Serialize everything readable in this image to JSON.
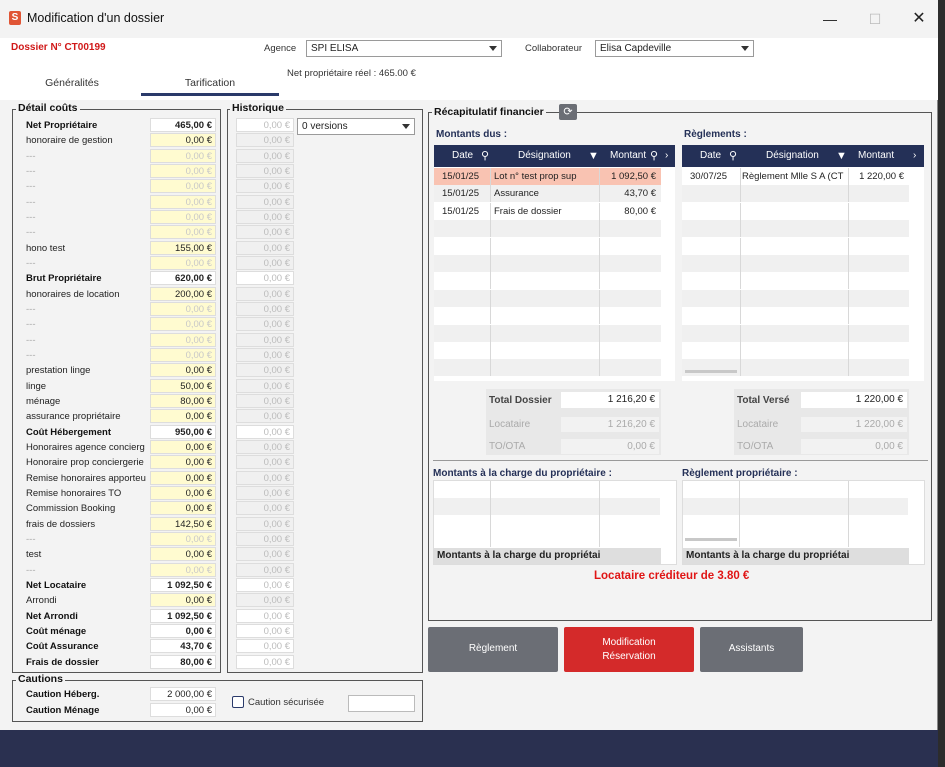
{
  "window": {
    "title": "Modification d'un dossier"
  },
  "header": {
    "dossier_label": "Dossier N° CT00199",
    "agence_label": "Agence",
    "agence_value": "SPI ELISA",
    "collaborateur_label": "Collaborateur",
    "collaborateur_value": "Elisa Capdeville",
    "net_proprietaire": "Net propriétaire réel : 465.00 €"
  },
  "tabs": [
    {
      "label": "Généralités"
    },
    {
      "label": "Tarification"
    }
  ],
  "detail": {
    "title": "Détail coûts",
    "rows": [
      {
        "label": "Net Propriétaire",
        "value": "465,00 €",
        "style": "bold-white"
      },
      {
        "label": "honoraire de gestion",
        "value": "0,00 €",
        "style": "yellow"
      },
      {
        "label": "---",
        "value": "0,00 €",
        "style": "dim"
      },
      {
        "label": "---",
        "value": "0,00 €",
        "style": "dim"
      },
      {
        "label": "---",
        "value": "0,00 €",
        "style": "dim"
      },
      {
        "label": "---",
        "value": "0,00 €",
        "style": "dim"
      },
      {
        "label": "---",
        "value": "0,00 €",
        "style": "dim"
      },
      {
        "label": "---",
        "value": "0,00 €",
        "style": "dim"
      },
      {
        "label": "hono test",
        "value": "155,00 €",
        "style": "yellow"
      },
      {
        "label": "---",
        "value": "0,00 €",
        "style": "dim"
      },
      {
        "label": "Brut Propriétaire",
        "value": "620,00 €",
        "style": "bold-white"
      },
      {
        "label": "honoraires  de location",
        "value": "200,00 €",
        "style": "yellow"
      },
      {
        "label": "---",
        "value": "0,00 €",
        "style": "dim"
      },
      {
        "label": "---",
        "value": "0,00 €",
        "style": "dim"
      },
      {
        "label": "---",
        "value": "0,00 €",
        "style": "dim"
      },
      {
        "label": "---",
        "value": "0,00 €",
        "style": "dim"
      },
      {
        "label": "prestation linge",
        "value": "0,00 €",
        "style": "yellow"
      },
      {
        "label": "linge",
        "value": "50,00 €",
        "style": "yellow"
      },
      {
        "label": "ménage",
        "value": "80,00 €",
        "style": "yellow"
      },
      {
        "label": "assurance propriétaire",
        "value": "0,00 €",
        "style": "yellow"
      },
      {
        "label": "Coût Hébergement",
        "value": "950,00 €",
        "style": "bold-white"
      },
      {
        "label": "Honoraires agence concierg",
        "value": "0,00 €",
        "style": "yellow"
      },
      {
        "label": "Honoraire prop conciergerie",
        "value": "0,00 €",
        "style": "yellow"
      },
      {
        "label": "Remise honoraires apporteu",
        "value": "0,00 €",
        "style": "yellow"
      },
      {
        "label": "Remise honoraires TO",
        "value": "0,00 €",
        "style": "yellow"
      },
      {
        "label": "Commission Booking",
        "value": "0,00 €",
        "style": "yellow"
      },
      {
        "label": "frais de dossiers",
        "value": "142,50 €",
        "style": "yellow"
      },
      {
        "label": "---",
        "value": "0,00 €",
        "style": "dim"
      },
      {
        "label": "test",
        "value": "0,00 €",
        "style": "yellow"
      },
      {
        "label": "---",
        "value": "0,00 €",
        "style": "dim"
      },
      {
        "label": "Net Locataire",
        "value": "1 092,50 €",
        "style": "bold-white"
      },
      {
        "label": "Arrondi",
        "value": "0,00 €",
        "style": "yellow"
      },
      {
        "label": "Net Arrondi",
        "value": "1 092,50 €",
        "style": "bold-white"
      },
      {
        "label": "Coût ménage",
        "value": "0,00 €",
        "style": "bold-white"
      },
      {
        "label": "Coût Assurance",
        "value": "43,70 €",
        "style": "bold-white"
      },
      {
        "label": "Frais de dossier",
        "value": "80,00 €",
        "style": "bold-white"
      }
    ]
  },
  "historique": {
    "title": "Historique",
    "versions": "0 versions",
    "value": "0,00 €"
  },
  "cautions": {
    "title": "Cautions",
    "heberg_label": "Caution Héberg.",
    "heberg_value": "2 000,00 €",
    "menage_label": "Caution Ménage",
    "menage_value": "0,00 €",
    "securisee_label": "Caution sécurisée"
  },
  "recap": {
    "title": "Récapitulatif financier",
    "montants_dus": {
      "title": "Montants dus :",
      "headers": [
        "Date",
        "Désignation",
        "Montant"
      ],
      "rows": [
        {
          "date": "15/01/25",
          "designation": "Lot n° test prop sup",
          "montant": "1 092,50 €"
        },
        {
          "date": "15/01/25",
          "designation": "Assurance",
          "montant": "43,70 €"
        },
        {
          "date": "15/01/25",
          "designation": "Frais de dossier",
          "montant": "80,00 €"
        }
      ]
    },
    "reglements": {
      "title": "Règlements :",
      "headers": [
        "Date",
        "Désignation",
        "Montant"
      ],
      "rows": [
        {
          "date": "30/07/25",
          "designation": "Règlement Mlle S A (CT",
          "montant": "1 220,00 €"
        }
      ]
    },
    "total_dossier_label": "Total Dossier",
    "total_dossier_value": "1 216,20 €",
    "locataire_label": "Locataire",
    "locataire_value": "1 216,20 €",
    "toota_label": "TO/OTA",
    "toota_value": "0,00 €",
    "total_verse_label": "Total Versé",
    "total_verse_value": "1 220,00 €",
    "locataire2_value": "1 220,00 €",
    "toota2_value": "0,00 €",
    "charge_proprio_title": "Montants à la charge du propriétaire :",
    "reglement_proprio_title": "Règlement propriétaire :",
    "charge_proprio_footer": "Montants à la charge du propriétai",
    "reglement_proprio_footer": "Montants à la charge du propriétai",
    "crediteur": "Locataire créditeur de 3.80 €"
  },
  "buttons": {
    "reglement": "Règlement",
    "modification_line1": "Modification",
    "modification_line2": "Réservation",
    "assistants": "Assistants"
  },
  "colors": {
    "accent_dark": "#243057",
    "red": "#d42a2a",
    "gray_button": "#6b6e75",
    "highlight_row": "#f9c3b2"
  }
}
